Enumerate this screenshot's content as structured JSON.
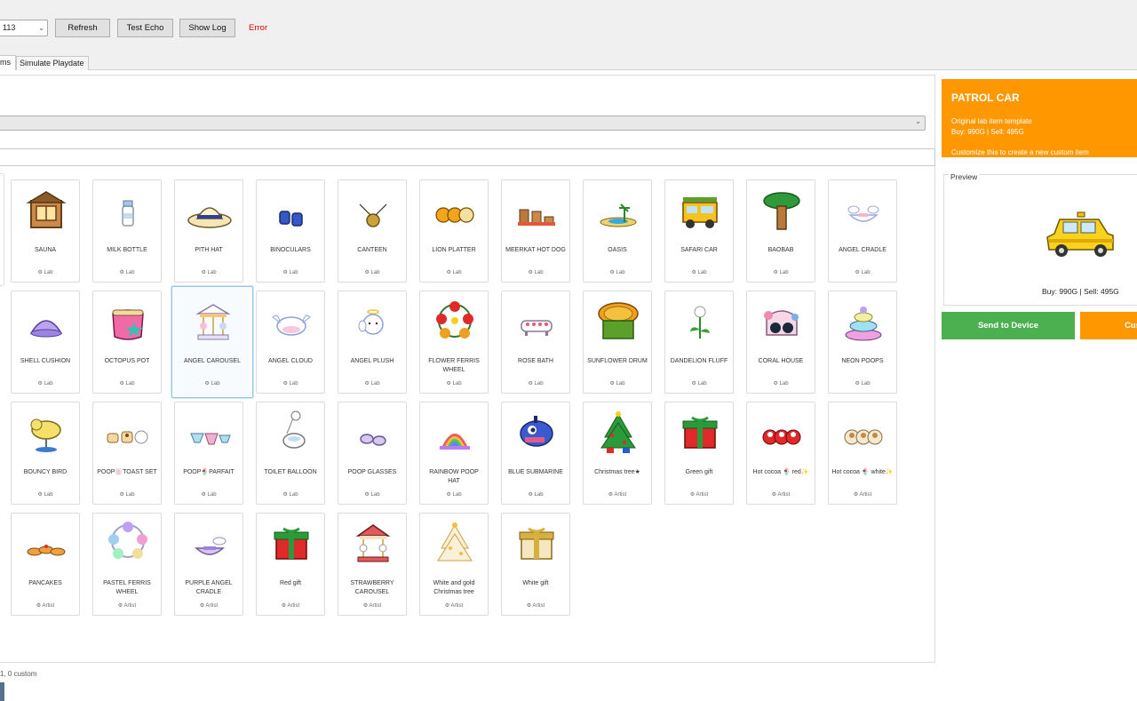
{
  "toolbar": {
    "device_combo_value": "113",
    "refresh_label": "Refresh",
    "test_echo_label": "Test Echo",
    "show_log_label": "Show Log",
    "status_text": "Error",
    "status_color": "#e00000"
  },
  "tabs": [
    {
      "label": "ms",
      "active": true
    },
    {
      "label": "Simulate Playdate",
      "active": false
    }
  ],
  "items": [
    {
      "name": "SAUNA",
      "source": "Lab",
      "icon": "sauna"
    },
    {
      "name": "MILK BOTTLE",
      "source": "Lab",
      "icon": "milk"
    },
    {
      "name": "PITH HAT",
      "source": "Lab",
      "icon": "hat"
    },
    {
      "name": "BINOCULARS",
      "source": "Lab",
      "icon": "binoc"
    },
    {
      "name": "CANTEEN",
      "source": "Lab",
      "icon": "canteen"
    },
    {
      "name": "LION PLATTER",
      "source": "Lab",
      "icon": "lion"
    },
    {
      "name": "MEERKAT HOT DOG",
      "source": "Lab",
      "icon": "meerkat"
    },
    {
      "name": "OASIS",
      "source": "Lab",
      "icon": "oasis"
    },
    {
      "name": "SAFARI CAR",
      "source": "Lab",
      "icon": "safari"
    },
    {
      "name": "BAOBAB",
      "source": "Lab",
      "icon": "baobab"
    },
    {
      "name": "ANGEL CRADLE",
      "source": "Lab",
      "icon": "acradle"
    },
    {
      "name": "SHELL CUSHION",
      "source": "Lab",
      "icon": "shell"
    },
    {
      "name": "OCTOPUS POT",
      "source": "Lab",
      "icon": "octopot"
    },
    {
      "name": "ANGEL CAROUSEL",
      "source": "Lab",
      "icon": "acarousel"
    },
    {
      "name": "ANGEL CLOUD",
      "source": "Lab",
      "icon": "acloud"
    },
    {
      "name": "ANGEL PLUSH",
      "source": "Lab",
      "icon": "aplush"
    },
    {
      "name": "FLOWER FERRIS WHEEL",
      "source": "Lab",
      "icon": "fferris"
    },
    {
      "name": "ROSE BATH",
      "source": "Lab",
      "icon": "rosebath"
    },
    {
      "name": "SUNFLOWER DRUM",
      "source": "Lab",
      "icon": "sunflower"
    },
    {
      "name": "DANDELION FLUFF",
      "source": "Lab",
      "icon": "dandelion"
    },
    {
      "name": "CORAL HOUSE",
      "source": "Lab",
      "icon": "coral"
    },
    {
      "name": "NEON POOPS",
      "source": "Lab",
      "icon": "neonpoop"
    },
    {
      "name": "BOUNCY BIRD",
      "source": "Lab",
      "icon": "bird"
    },
    {
      "name": "POOP🍥TOAST SET",
      "source": "Lab",
      "icon": "toast"
    },
    {
      "name": "POOP🍨PARFAIT",
      "source": "Lab",
      "icon": "parfait"
    },
    {
      "name": "TOILET BALLOON",
      "source": "Lab",
      "icon": "toilet"
    },
    {
      "name": "POOP GLASSES",
      "source": "Lab",
      "icon": "glasses"
    },
    {
      "name": "RAINBOW POOP HAT",
      "source": "Lab",
      "icon": "rainbow"
    },
    {
      "name": "BLUE SUBMARINE",
      "source": "Lab",
      "icon": "sub"
    },
    {
      "name": "Christmas tree★",
      "source": "Artist",
      "icon": "xmas"
    },
    {
      "name": "Green gift",
      "source": "Artist",
      "icon": "ggift"
    },
    {
      "name": "Hot cocoa 🍨 red✨",
      "source": "Artist",
      "icon": "cocoared"
    },
    {
      "name": "Hot cocoa 🍨 white✨",
      "source": "Artist",
      "icon": "cocoawhite"
    },
    {
      "name": "PANCAKES",
      "source": "Artist",
      "icon": "pancakes"
    },
    {
      "name": "PASTEL FERRIS WHEEL",
      "source": "Artist",
      "icon": "pferris"
    },
    {
      "name": "PURPLE ANGEL CRADLE",
      "source": "Artist",
      "icon": "pcradle"
    },
    {
      "name": "Red gift",
      "source": "Artist",
      "icon": "rgift"
    },
    {
      "name": "STRAWBERRY CAROUSEL",
      "source": "Artist",
      "icon": "scarousel"
    },
    {
      "name": "White and gold Christmas tree",
      "source": "Artist",
      "icon": "wgtree"
    },
    {
      "name": "White gift",
      "source": "Artist",
      "icon": "wgift"
    }
  ],
  "selected_index": 13,
  "status_bar": "1, 0 custom",
  "detail": {
    "title": "PATROL CAR",
    "subtitle": "Original lab item template",
    "price_line": "Buy: 990G | Sell: 495G",
    "hint": "Customize this to create a new custom item",
    "accent_color": "#ff9800",
    "preview_label": "Preview",
    "preview_price": "Buy: 990G | Sell: 495G",
    "send_label": "Send to Device",
    "send_color": "#4caf50",
    "customize_label": "Customize"
  }
}
